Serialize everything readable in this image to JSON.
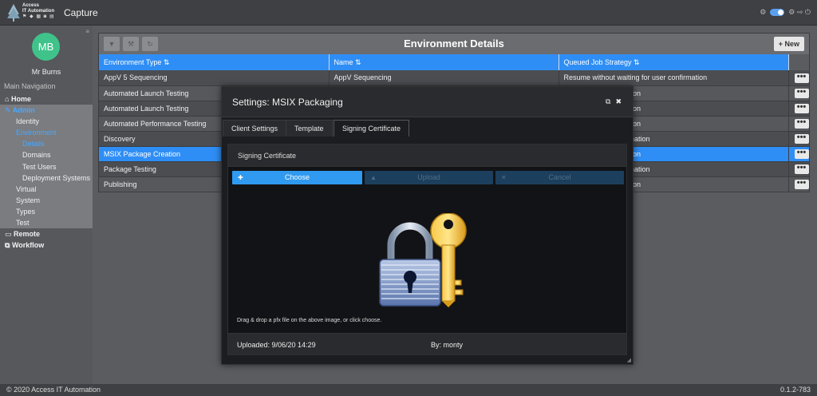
{
  "header": {
    "brand_line1": "Access",
    "brand_line2": "IT Automation",
    "brand_icons": "⚑ ◆ ▦ ◙ ▤",
    "app_title": "Capture",
    "controls": "⚙ ⇨ ⏻"
  },
  "sidebar": {
    "avatar_initials": "MB",
    "user_name": "Mr Burns",
    "nav_title": "Main Navigation",
    "items": [
      {
        "label": "Home",
        "icon": "⌂"
      },
      {
        "label": "Admin",
        "icon": "✎"
      },
      {
        "label": "Identity"
      },
      {
        "label": "Environment"
      },
      {
        "label": "Details"
      },
      {
        "label": "Domains"
      },
      {
        "label": "Test Users"
      },
      {
        "label": "Deployment Systems"
      },
      {
        "label": "Virtual"
      },
      {
        "label": "System"
      },
      {
        "label": "Types"
      },
      {
        "label": "Test"
      },
      {
        "label": "Remote",
        "icon": "▭"
      },
      {
        "label": "Workflow",
        "icon": "⧉"
      }
    ]
  },
  "panel": {
    "title": "Environment Details",
    "new_label": "New",
    "new_icon": "+",
    "columns": [
      "Environment Type ⇅",
      "Name ⇅",
      "Queued Job Strategy ⇅",
      ""
    ],
    "rows": [
      {
        "type": "AppV 5 Sequencing",
        "name": "AppV Sequencing",
        "strategy": "Resume without waiting for user confirmation"
      },
      {
        "type": "Automated Launch Testing",
        "name": "",
        "strategy": "ing for user confirmation"
      },
      {
        "type": "Automated Launch Testing",
        "name": "",
        "strategy": "ing for user confirmation"
      },
      {
        "type": "Automated Performance Testing",
        "name": "",
        "strategy": "ing for user confirmation"
      },
      {
        "type": "Discovery",
        "name": "",
        "strategy": "d wait for user confirmation"
      },
      {
        "type": "MSIX Package Creation",
        "name": "",
        "strategy": "ing for user confirmation"
      },
      {
        "type": "Package Testing",
        "name": "",
        "strategy": "d wait for user confirmation"
      },
      {
        "type": "Publishing",
        "name": "",
        "strategy": "ing for user confirmation"
      }
    ],
    "more_label": "•••"
  },
  "modal": {
    "title": "Settings: MSIX Packaging",
    "tabs": [
      "Client Settings",
      "Template",
      "Signing Certificate"
    ],
    "section_title": "Signing Certificate",
    "choose_label": "Choose",
    "upload_label": "Upload",
    "cancel_label": "Cancel",
    "drop_hint": "Drag & drop a pfx file on the above image, or click choose.",
    "uploaded": "Uploaded: 9/06/20 14:29",
    "by": "By: monty"
  },
  "footer": {
    "copyright": "© 2020 Access IT Automation",
    "version": "0.1.2-783"
  },
  "colors": {
    "accent": "#2f8ef5",
    "avatar": "#3fc38a",
    "selected_row": "#2f8ef5"
  }
}
